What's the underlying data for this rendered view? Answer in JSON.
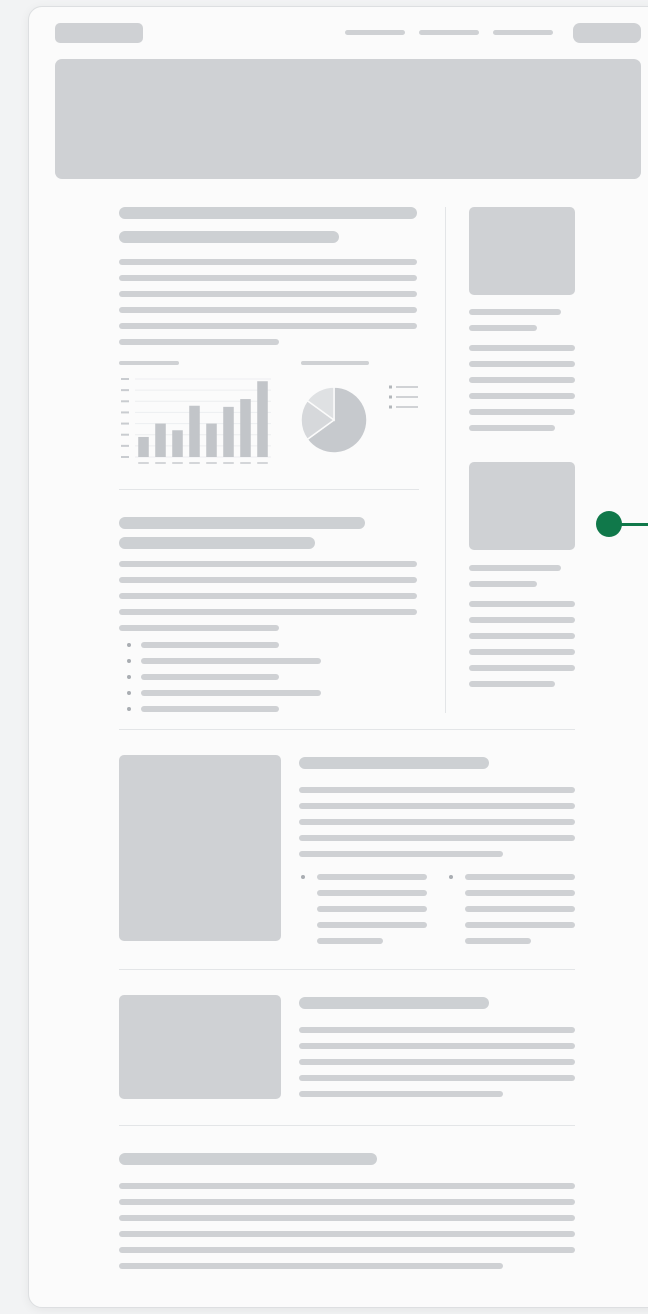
{
  "wireframe": {
    "nav_links": [
      "",
      "",
      ""
    ],
    "accent_color": "#10784a",
    "placeholder_color": "#cfd1d4"
  },
  "chart_data": [
    {
      "type": "bar",
      "title": "",
      "categories": [
        "",
        "",
        "",
        "",
        "",
        "",
        "",
        ""
      ],
      "values": [
        18,
        30,
        24,
        46,
        30,
        45,
        52,
        68
      ],
      "ylim": [
        0,
        70
      ],
      "grid": true
    },
    {
      "type": "pie",
      "title": "",
      "labels": [
        "",
        "",
        ""
      ],
      "values": [
        65,
        20,
        15
      ]
    }
  ],
  "resize_handle": {
    "icon": "drag-handle-icon",
    "color": "#10784a"
  }
}
